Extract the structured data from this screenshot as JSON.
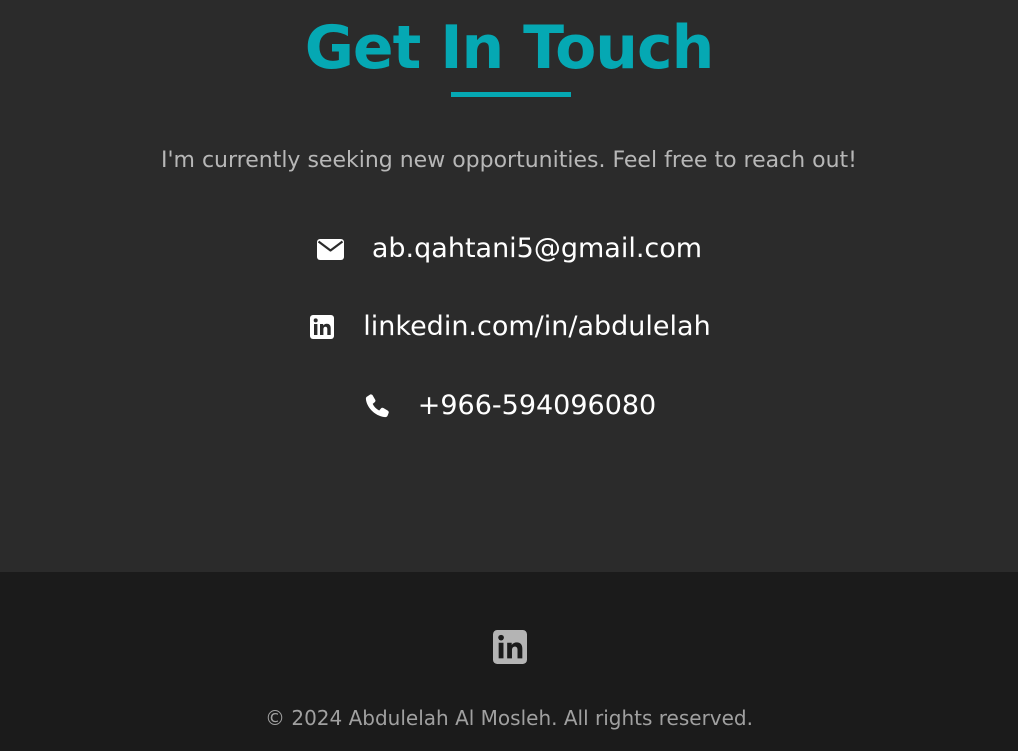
{
  "colors": {
    "accent": "#05a8b3",
    "background": "#2b2b2b",
    "footer_background": "#1b1b1b",
    "text": "#ffffff",
    "muted_text": "#b7b7b7"
  },
  "contact": {
    "title": "Get In Touch",
    "subtitle": "I'm currently seeking new opportunities. Feel free to reach out!",
    "items": [
      {
        "icon": "envelope-icon",
        "text": "ab.qahtani5@gmail.com"
      },
      {
        "icon": "linkedin-icon",
        "text": "linkedin.com/in/abdulelah"
      },
      {
        "icon": "phone-icon",
        "text": "+966-594096080"
      }
    ]
  },
  "footer": {
    "social_icon": "linkedin-icon",
    "copyright": "© 2024 Abdulelah Al Mosleh. All rights reserved."
  }
}
